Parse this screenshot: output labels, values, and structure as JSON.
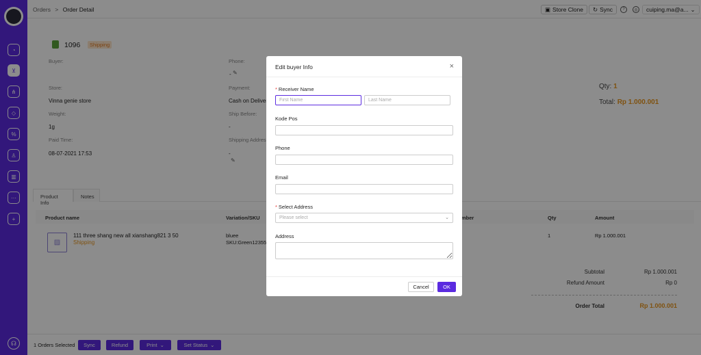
{
  "topbar": {
    "breadcrumb_root": "Orders",
    "breadcrumb_sep": ">",
    "breadcrumb_current": "Order Detail",
    "store_clone": "Store Clone",
    "sync": "Sync",
    "user": "cuiping.ma@a..."
  },
  "order": {
    "number": "1096",
    "status": "Shipping",
    "buyer_label": "Buyer:",
    "phone_label": "Phone:",
    "phone_value": "-",
    "store_label": "Store:",
    "store_value": "Vinna genie store",
    "payment_label": "Payment:",
    "payment_value": "Cash on Deliver",
    "weight_label": "Weight:",
    "weight_value": "1g",
    "ship_before_label": "Ship Before:",
    "ship_before_value": "-",
    "paid_time_label": "Paid Time:",
    "paid_time_value": "08-07-2021 17:53",
    "shipping_address_label": "Shipping Address",
    "shipping_address_value": "-",
    "qty_label": "Qty:",
    "qty_value": "1",
    "total_label": "Total:",
    "total_value": "Rp 1.000.001"
  },
  "tabs": [
    "Product Info",
    "Notes"
  ],
  "table": {
    "headers": [
      "Product name",
      "Variation/SKU",
      "mber",
      "Qty",
      "Amount"
    ],
    "row": {
      "name": "111 three shang new all xianshang821 3 50",
      "status": "Shipping",
      "variation": "bluee",
      "sku": "SKU:Green12355",
      "qty": "1",
      "amount": "Rp 1.000.001"
    }
  },
  "summary": {
    "subtotal_label": "Subtotal",
    "subtotal_value": "Rp 1.000.001",
    "refund_label": "Refund Amount",
    "refund_value": "Rp 0",
    "total_label": "Order Total",
    "total_value": "Rp 1.000.001"
  },
  "footer": {
    "selected": "1 Orders Selected",
    "sync": "Sync",
    "refund": "Refund",
    "print": "Print",
    "set_status": "Set Status"
  },
  "modal": {
    "title": "Edit buyer Info",
    "receiver_name_label": "Receiver Name",
    "first_name_placeholder": "First Name",
    "last_name_placeholder": "Last Name",
    "kode_pos_label": "Kode Pos",
    "phone_label": "Phone",
    "email_label": "Email",
    "select_address_label": "Select Address",
    "select_placeholder": "Please select",
    "address_label": "Address",
    "cancel": "Cancel",
    "ok": "OK"
  },
  "colors": {
    "accent": "#5b2be0",
    "amount_orange": "#e8951e",
    "required": "#e53935"
  }
}
